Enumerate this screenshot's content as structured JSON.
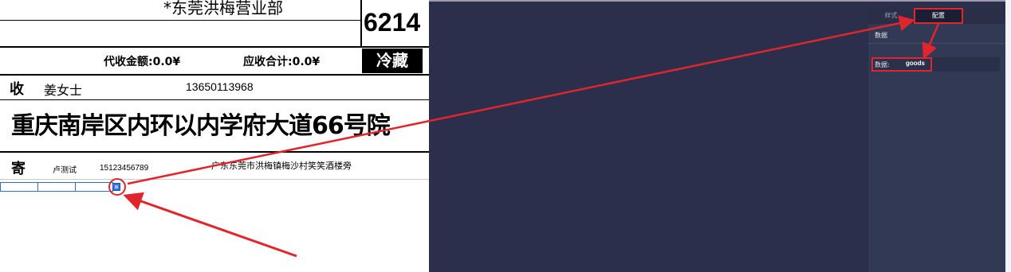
{
  "label": {
    "sender_org": "*东莞洪梅营业部",
    "code": "6214",
    "cod_amount": "代收金额:0.0¥",
    "total_due": "应收合计:0.0¥",
    "cold_tag": "冷藏",
    "receiver": {
      "tag": "收",
      "name": "姜女士",
      "phone": "13650113968",
      "address": "重庆南岸区内环以内学府大道66号院"
    },
    "sender": {
      "tag": "寄",
      "name": "卢测试",
      "phone": "15123456789",
      "address": "广东东莞市洪梅镇梅沙村笑笑酒楼旁"
    }
  },
  "config_panel": {
    "tabs": [
      {
        "label": "样式",
        "active": false
      },
      {
        "label": "配置",
        "active": true
      }
    ],
    "section_title": "数据",
    "data_field": {
      "label": "数据:",
      "value": "goods"
    }
  },
  "colors": {
    "annotation_red": "#e0262c",
    "app_background": "#2b2f4b",
    "panel_background": "#323955",
    "selection_blue": "#3b74e0"
  }
}
